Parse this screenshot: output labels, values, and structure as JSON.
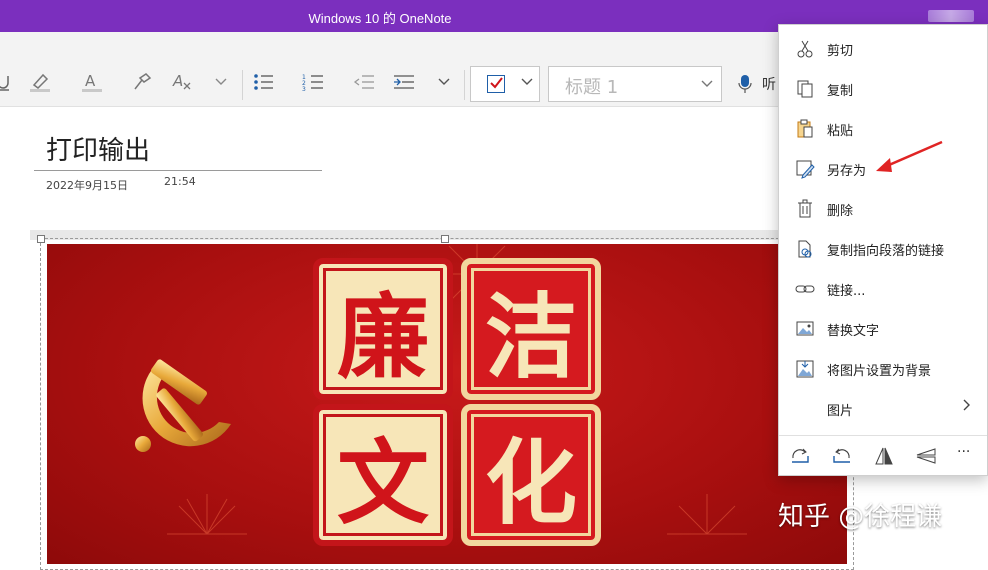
{
  "window": {
    "title": "Windows 10 的 OneNote"
  },
  "ribbon": {
    "style_selector": "标题 1",
    "dictate_label": "听"
  },
  "page": {
    "title": "打印输出",
    "date": "2022年9月15日",
    "time": "21:54"
  },
  "poster": {
    "chars": [
      "廉",
      "洁",
      "文",
      "化"
    ]
  },
  "context_menu": {
    "items": [
      {
        "label": "剪切",
        "icon": "scissors-icon"
      },
      {
        "label": "复制",
        "icon": "copy-icon"
      },
      {
        "label": "粘贴",
        "icon": "paste-icon"
      },
      {
        "label": "另存为",
        "icon": "save-as-icon"
      },
      {
        "label": "删除",
        "icon": "trash-icon"
      },
      {
        "label": "复制指向段落的链接",
        "icon": "link-copy-icon"
      },
      {
        "label": "链接...",
        "icon": "link-icon"
      },
      {
        "label": "替换文字",
        "icon": "alt-text-icon"
      },
      {
        "label": "将图片设置为背景",
        "icon": "image-background-icon"
      },
      {
        "label": "图片",
        "icon": "picture-submenu"
      }
    ],
    "bottom_actions": [
      "rotate-right-icon",
      "rotate-left-icon",
      "flip-horizontal-icon",
      "flip-vertical-icon",
      "more-icon"
    ],
    "more_label": "···"
  },
  "annotation": {
    "color": "#e02424"
  },
  "watermark": "知乎 @徐程谦",
  "colors": {
    "titlebar": "#7b2fbe",
    "poster_red": "#c81a1a",
    "tile_cream": "#f7e6b8"
  }
}
